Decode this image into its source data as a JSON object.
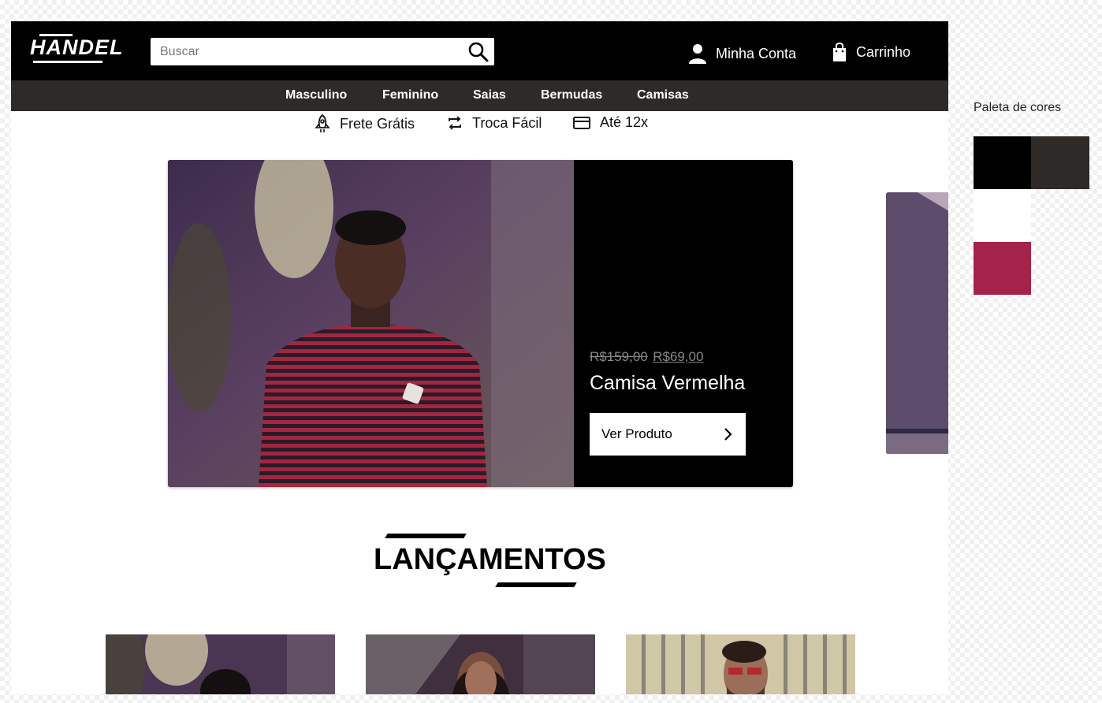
{
  "app": {
    "logo": "HANDEL"
  },
  "search": {
    "placeholder": "Buscar"
  },
  "header": {
    "account_label": "Minha Conta",
    "cart_label": "Carrinho"
  },
  "nav": {
    "items": [
      "Masculino",
      "Feminino",
      "Saias",
      "Bermudas",
      "Camisas"
    ]
  },
  "perks": [
    {
      "icon": "rocket-icon",
      "label": "Frete Grátis"
    },
    {
      "icon": "exchange-icon",
      "label": "Troca Fácil"
    },
    {
      "icon": "credit-card-icon",
      "label": "Até 12x"
    }
  ],
  "hero": {
    "price_old": "R$159,00",
    "price_new": "R$69,00",
    "product_title": "Camisa Vermelha",
    "button_label": "Ver Produto"
  },
  "section": {
    "title": "LANÇAMENTOS"
  },
  "palette": {
    "label": "Paleta de cores",
    "colors": [
      "#000000",
      "#2e2a27",
      "#ffffff",
      "#a3234a"
    ]
  }
}
